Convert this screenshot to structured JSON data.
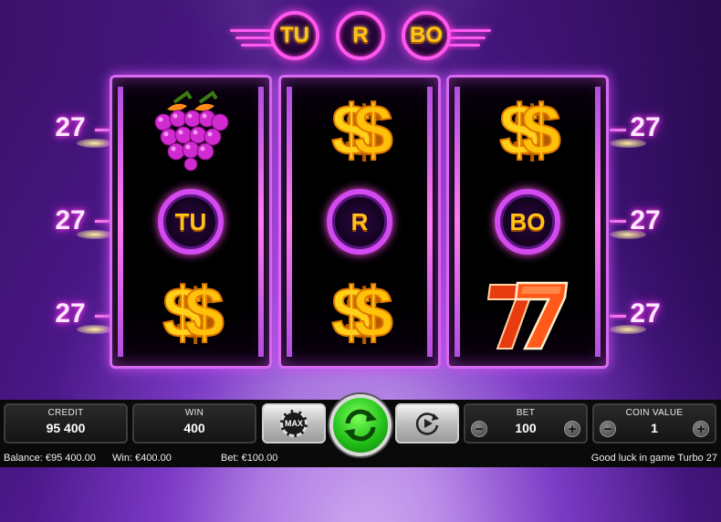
{
  "logo": {
    "letters": [
      "TU",
      "R",
      "BO"
    ]
  },
  "line_numbers": {
    "left": [
      "27",
      "27",
      "27"
    ],
    "right": [
      "27",
      "27",
      "27"
    ]
  },
  "reels": [
    [
      "grapes",
      "tu-ring",
      "dollar"
    ],
    [
      "dollar",
      "r-ring",
      "dollar"
    ],
    [
      "dollar",
      "bo-ring",
      "seven"
    ]
  ],
  "ring_labels": {
    "tu": "TU",
    "r": "R",
    "bo": "BO"
  },
  "panel": {
    "credit": {
      "label": "CREDIT",
      "value": "95 400"
    },
    "win": {
      "label": "WIN",
      "value": "400"
    },
    "max_label": "MAX",
    "bet": {
      "label": "BET",
      "value": "100"
    },
    "coin_value": {
      "label": "COIN VALUE",
      "value": "1"
    }
  },
  "status_bar": {
    "balance": "Balance: €95 400.00",
    "win": "Win: €400.00",
    "bet": "Bet: €100.00",
    "message": "Good luck in game Turbo 27"
  },
  "colors": {
    "neon_pink": "#ff58ee",
    "gold": "#ffc41a",
    "spin_green": "#23c21a"
  }
}
